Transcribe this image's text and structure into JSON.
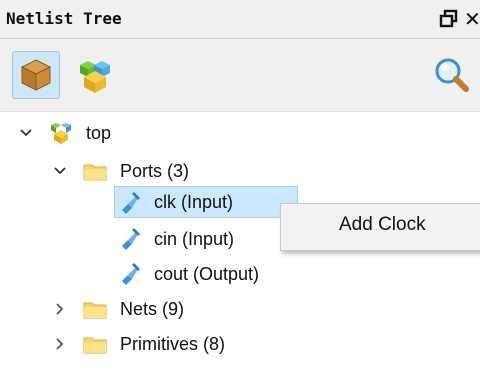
{
  "panel": {
    "title": "Netlist Tree",
    "restore_icon": "restore-window-icon",
    "close_label": "✕"
  },
  "toolbar": {
    "buttons": [
      {
        "icon": "box-icon",
        "active": true
      },
      {
        "icon": "multi-box-icon",
        "active": false
      }
    ],
    "search_icon": "magnifier-icon"
  },
  "tree": {
    "root": {
      "label": "top"
    },
    "ports": {
      "label": "Ports (3)"
    },
    "port_items": [
      {
        "label": "clk (Input)"
      },
      {
        "label": "cin (Input)"
      },
      {
        "label": "cout (Output)"
      }
    ],
    "nets": {
      "label": "Nets (9)"
    },
    "primitives": {
      "label": "Primitives (8)"
    }
  },
  "context_menu": {
    "items": [
      {
        "label": "Add Clock"
      }
    ]
  }
}
